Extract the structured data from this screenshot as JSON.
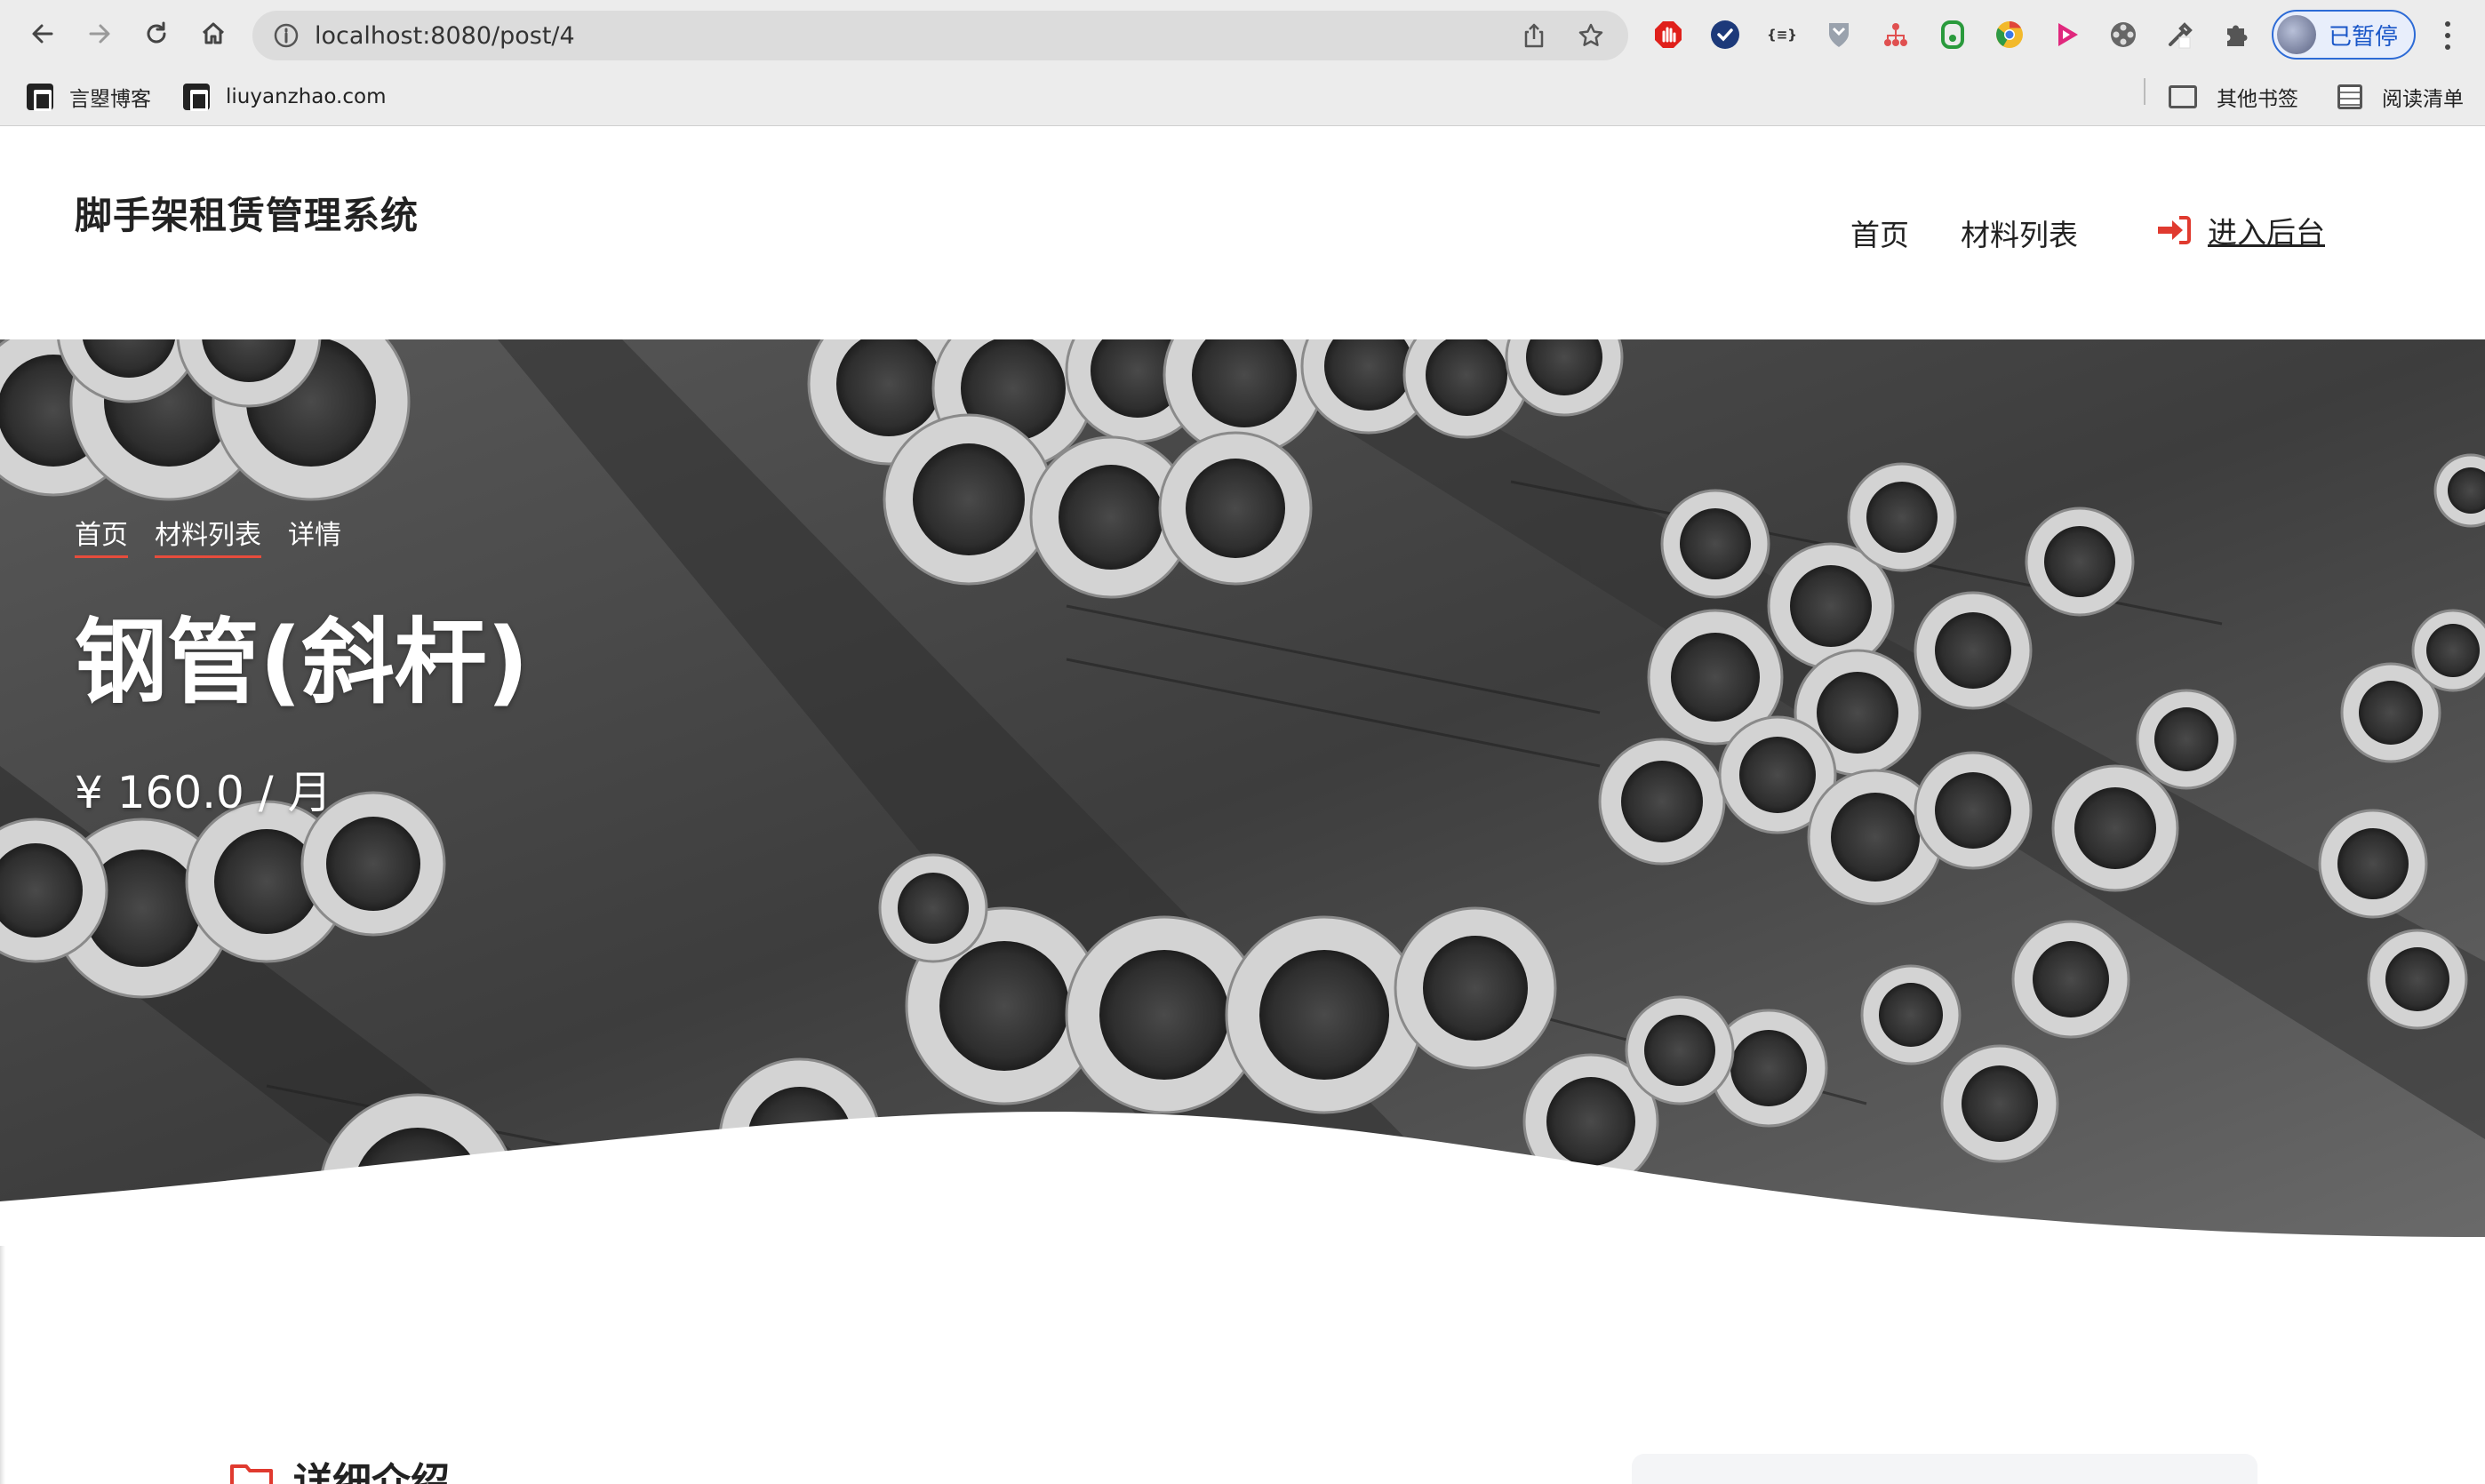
{
  "browser": {
    "url": "localhost:8080/post/4",
    "profile_label": "已暂停",
    "bookmarks": [
      {
        "label": "言曌博客"
      },
      {
        "label": "liuyanzhao.com"
      }
    ],
    "other_bookmarks": "其他书签",
    "reading_list": "阅读清单",
    "extensions": [
      "adblock-icon",
      "check-icon",
      "json-icon",
      "shield-icon",
      "tree-icon",
      "recycle-icon",
      "chrome-icon",
      "play-icon",
      "film-icon",
      "eyedropper-icon",
      "puzzle-icon"
    ],
    "ext_json_text": "{≡}"
  },
  "header": {
    "brand": "脚手架租赁管理系统",
    "nav": [
      "首页",
      "材料列表"
    ],
    "admin_link": "进入后台"
  },
  "hero": {
    "breadcrumb": [
      "首页",
      "材料列表",
      "详情"
    ],
    "title": "钢管(斜杆)",
    "price": "¥ 160.0 / 月"
  },
  "content": {
    "detail_heading": "详细介绍"
  },
  "colors": {
    "accent": "#e03a2f",
    "profile_blue": "#1a57c8"
  }
}
